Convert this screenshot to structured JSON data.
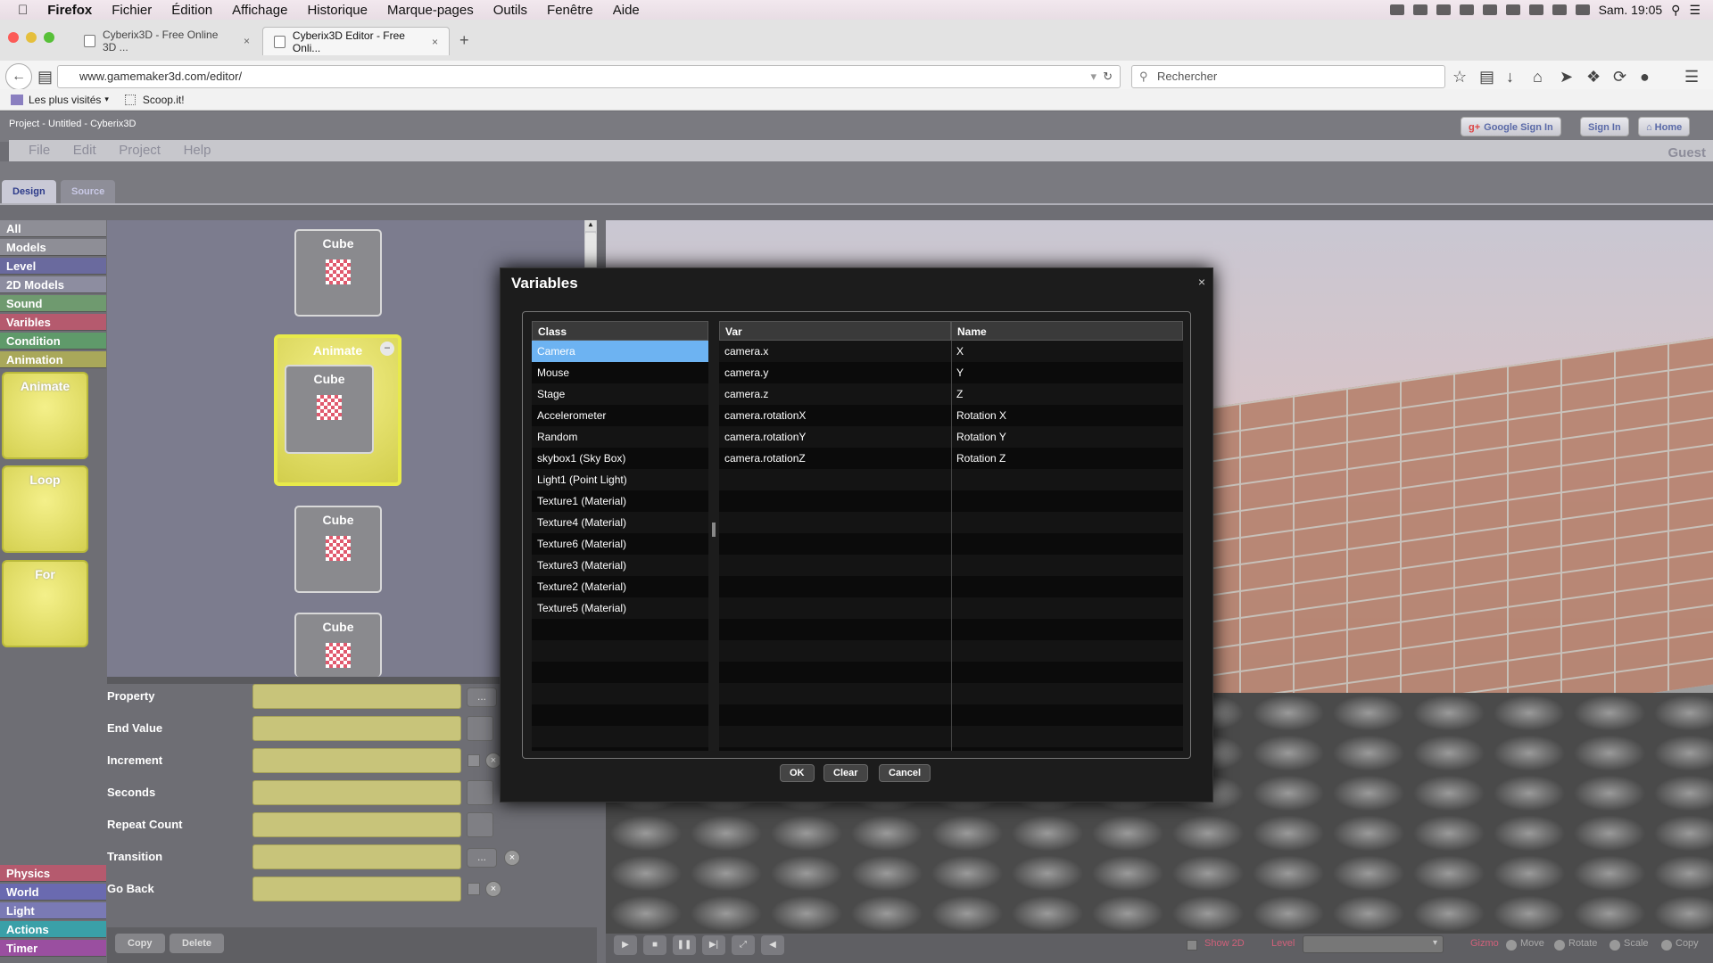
{
  "mac_menubar": {
    "app": "Firefox",
    "items": [
      "Fichier",
      "Édition",
      "Affichage",
      "Historique",
      "Marque-pages",
      "Outils",
      "Fenêtre",
      "Aide"
    ],
    "clock": "Sam. 19:05"
  },
  "browser": {
    "tabs": [
      {
        "title": "Cyberix3D - Free Online 3D ..."
      },
      {
        "title": "Cyberix3D Editor - Free Onli..."
      }
    ],
    "url": "www.gamemaker3d.com/editor/",
    "search_placeholder": "Rechercher",
    "bookmarks": [
      "Les plus visités",
      "Scoop.it!"
    ]
  },
  "app": {
    "title": "Project - Untitled - Cyberix3D",
    "header_buttons": [
      "Google Sign In",
      "Sign In",
      "Home"
    ],
    "menu": [
      "File",
      "Edit",
      "Project",
      "Help"
    ],
    "user": "Guest",
    "tabs": [
      "Design",
      "Source"
    ]
  },
  "sidebar": {
    "categories_top": [
      {
        "label": "All",
        "color": "#8e8e96"
      },
      {
        "label": "Models",
        "color": "#8e8e96"
      },
      {
        "label": "Level",
        "color": "#6a6a9e"
      },
      {
        "label": "2D Models",
        "color": "#8d8da0"
      },
      {
        "label": "Sound",
        "color": "#6f9a6f"
      },
      {
        "label": "Varibles",
        "color": "#b55a6e"
      },
      {
        "label": "Condition",
        "color": "#5f9a6a"
      },
      {
        "label": "Animation",
        "color": "#a9a85a"
      }
    ],
    "blocks": [
      "Animate",
      "Loop",
      "For"
    ],
    "categories_bottom": [
      {
        "label": "Physics",
        "color": "#b55a6e"
      },
      {
        "label": "World",
        "color": "#6a6ab0"
      },
      {
        "label": "Light",
        "color": "#7a7ab5"
      },
      {
        "label": "Actions",
        "color": "#3aa0a8"
      },
      {
        "label": "Timer",
        "color": "#9a4fa0"
      }
    ]
  },
  "canvas": {
    "cards": [
      "Cube",
      "Cube",
      "Cube",
      "Cube"
    ],
    "animate_block": {
      "title": "Animate",
      "inner": "Cube"
    }
  },
  "properties": {
    "labels": [
      "Property",
      "End Value",
      "Increment",
      "Seconds",
      "Repeat Count",
      "Transition",
      "Go Back"
    ],
    "browse_label": "...",
    "footer_buttons": [
      "Copy",
      "Delete"
    ]
  },
  "bottom_toolbar": {
    "show2d": "Show 2D",
    "level_label": "Level",
    "gizmo": "Gizmo",
    "modes": [
      "Move",
      "Rotate",
      "Scale",
      "Copy"
    ]
  },
  "dialog": {
    "title": "Variables",
    "close": "×",
    "columns": [
      "Class",
      "Var",
      "Name"
    ],
    "classes": [
      "Camera",
      "Mouse",
      "Stage",
      "Accelerometer",
      "Random",
      "skybox1 (Sky Box)",
      "Light1 (Point Light)",
      "Texture1 (Material)",
      "Texture4 (Material)",
      "Texture6 (Material)",
      "Texture3 (Material)",
      "Texture2 (Material)",
      "Texture5 (Material)"
    ],
    "selected_class": "Camera",
    "vars": [
      {
        "var": "camera.x",
        "name": "X"
      },
      {
        "var": "camera.y",
        "name": "Y"
      },
      {
        "var": "camera.z",
        "name": "Z"
      },
      {
        "var": "camera.rotationX",
        "name": "Rotation X"
      },
      {
        "var": "camera.rotationY",
        "name": "Rotation Y"
      },
      {
        "var": "camera.rotationZ",
        "name": "Rotation Z"
      }
    ],
    "buttons": [
      "OK",
      "Clear",
      "Cancel"
    ]
  }
}
